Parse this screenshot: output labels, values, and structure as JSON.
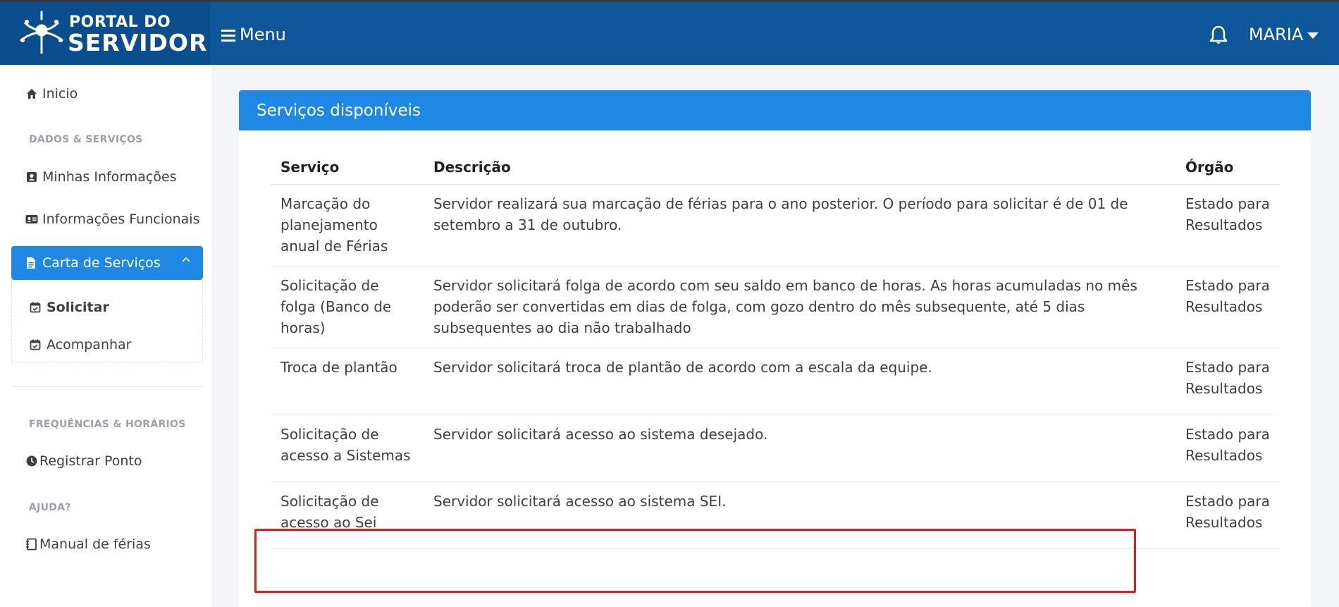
{
  "header": {
    "brand_top": "PORTAL DO",
    "brand_bottom": "SERVIDOR",
    "menu_label": "Menu",
    "user_name": "MARIA",
    "icons": [
      "logo-icon",
      "hamburger-icon",
      "bell-icon",
      "caret-down-icon"
    ]
  },
  "sidebar": {
    "home": "Inicio",
    "section_dados": "DADOS & SERVIÇOS",
    "minhas_info": "Minhas Informações",
    "info_funcionais": "Informações Funcionais",
    "carta_servicos": "Carta de Serviços",
    "solicitar": "Solicitar",
    "acompanhar": "Acompanhar",
    "section_frequencias": "FREQUÊNCIAS & HORÁRIOS",
    "registrar_ponto": "Registrar Ponto",
    "section_ajuda": "AJUDA?",
    "manual_ferias": "Manual de férias"
  },
  "card": {
    "title": "Serviços disponíveis",
    "columns": [
      "Serviço",
      "Descrição",
      "Órgão"
    ],
    "rows": [
      {
        "servico": "Marcação do planejamento anual de Férias",
        "descricao": "Servidor realizará sua marcação de férias para o ano posterior. O período para solicitar é de 01 de setembro a 31 de outubro.",
        "orgao": "Estado para Resultados"
      },
      {
        "servico": "Solicitação de folga (Banco de horas)",
        "descricao": "Servidor solicitará folga de acordo com seu saldo em banco de horas. As horas acumuladas no mês poderão ser convertidas em dias de folga, com gozo dentro do mês subsequente, até 5 dias subsequentes ao dia não trabalhado",
        "orgao": "Estado para Resultados"
      },
      {
        "servico": "Troca de plantão",
        "descricao": "Servidor solicitará troca de plantão de acordo com a escala da equipe.",
        "orgao": "Estado para Resultados"
      },
      {
        "servico": "Solicitação de acesso a Sistemas",
        "descricao": "Servidor solicitará acesso ao sistema desejado.",
        "orgao": "Estado para Resultados"
      },
      {
        "servico": "Solicitação de acesso ao Sei",
        "descricao": "Servidor solicitará acesso ao sistema SEI.",
        "orgao": "Estado para Resultados"
      }
    ]
  },
  "colors": {
    "header_bg": "#0d579a",
    "accent": "#1f88e5",
    "highlight_border": "#e31b1b"
  }
}
